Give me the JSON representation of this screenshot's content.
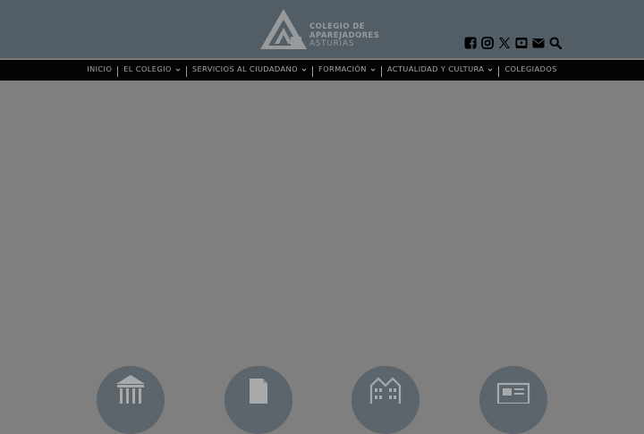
{
  "header": {
    "logo": {
      "line1": "COLEGIO DE",
      "line2": "APAREJADORES",
      "line3": "ASTURIAS"
    },
    "social_icons": [
      "facebook-icon",
      "instagram-icon",
      "x-icon",
      "youtube-icon",
      "email-icon",
      "search-icon"
    ]
  },
  "nav": {
    "items": [
      {
        "label": "INICIO",
        "has_dropdown": false
      },
      {
        "label": "EL COLEGIO",
        "has_dropdown": true
      },
      {
        "label": "SERVICIOS AL CIUDADANO",
        "has_dropdown": true
      },
      {
        "label": "FORMACIÓN",
        "has_dropdown": true
      },
      {
        "label": "ACTUALIDAD Y CULTURA",
        "has_dropdown": true
      },
      {
        "label": "COLEGIADOS",
        "has_dropdown": false
      }
    ]
  },
  "feature_icons": [
    "pavilion-icon",
    "document-icon",
    "buildings-icon",
    "news-icon"
  ],
  "colors": {
    "header_bg": "#535d65",
    "nav_bg": "#040404",
    "page_bg": "#7f7f7f",
    "text_muted": "#a5a5a5"
  }
}
